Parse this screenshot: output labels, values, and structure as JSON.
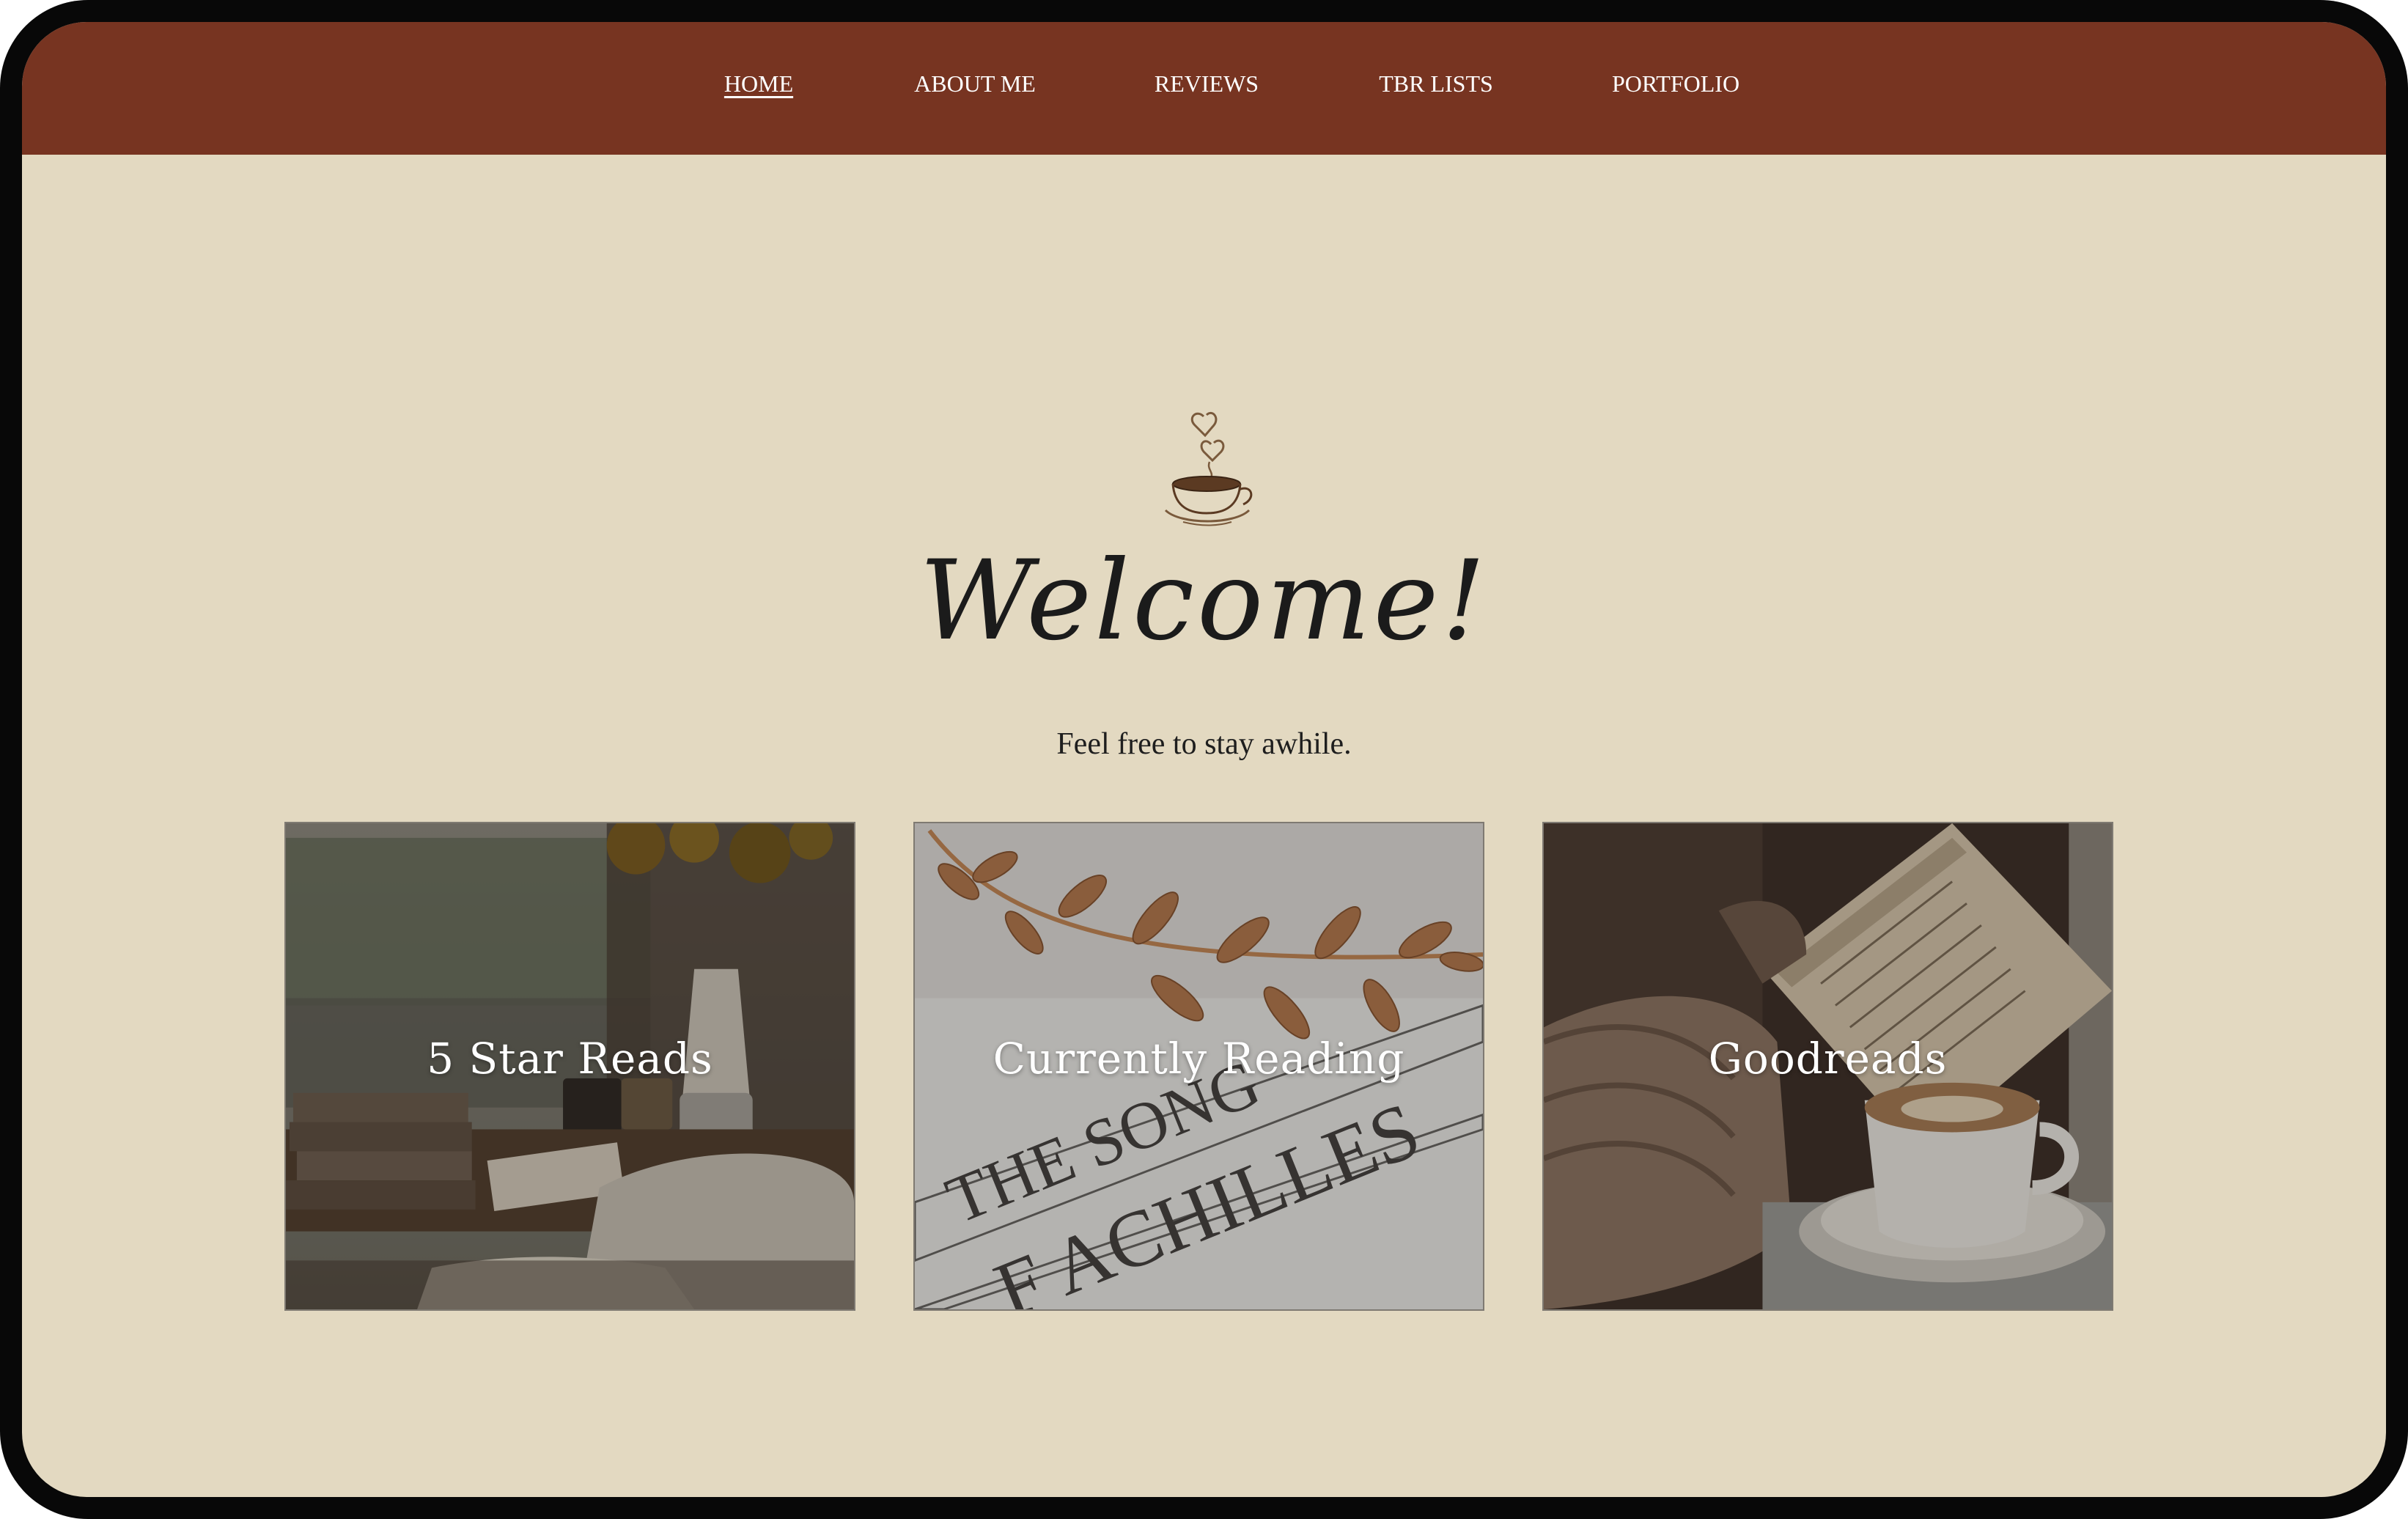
{
  "nav": {
    "items": [
      {
        "label": "HOME",
        "active": true
      },
      {
        "label": "ABOUT ME",
        "active": false
      },
      {
        "label": "REVIEWS",
        "active": false
      },
      {
        "label": "TBR LISTS",
        "active": false
      },
      {
        "label": "PORTFOLIO",
        "active": false
      }
    ]
  },
  "hero": {
    "icon": "coffee-cup-hearts-icon",
    "title": "Welcome!",
    "subtitle": "Feel free to stay awhile."
  },
  "cards": [
    {
      "label": "5 Star Reads",
      "image": "rainy-window-books-sunflowers-photo"
    },
    {
      "label": "Currently Reading",
      "image": "song-of-achilles-laurel-photo",
      "image_text": [
        "THE SONG",
        "F ACHILLES"
      ]
    },
    {
      "label": "Goodreads",
      "image": "open-book-latte-sweater-photo"
    }
  ],
  "colors": {
    "nav_bg": "#773421",
    "page_bg": "#e3d9c1",
    "frame": "#080808",
    "text_dark": "#1b1b1b",
    "nav_text": "#ffffff"
  }
}
